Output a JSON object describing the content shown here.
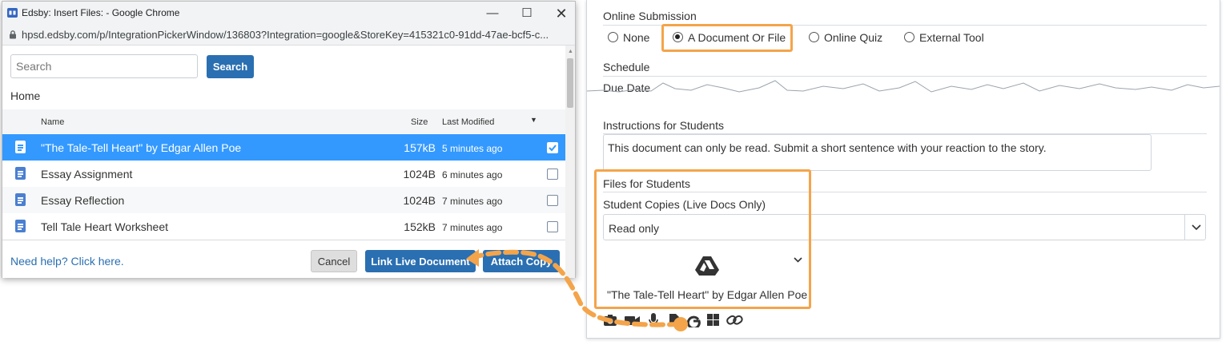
{
  "popup": {
    "title": "Edsby: Insert Files: - Google Chrome",
    "url": "hpsd.edsby.com/p/IntegrationPickerWindow/136803?Integration=google&StoreKey=415321c0-91dd-47ae-bcf5-c...",
    "search_placeholder": "Search",
    "search_button": "Search",
    "folder": "Home",
    "columns": {
      "name": "Name",
      "size": "Size",
      "modified": "Last Modified"
    },
    "files": [
      {
        "name": "\"The Tale-Tell Heart\" by Edgar Allen Poe",
        "size": "157kB",
        "modified": "5 minutes ago",
        "selected": true
      },
      {
        "name": "Essay Assignment",
        "size": "1024B",
        "modified": "6 minutes ago",
        "selected": false
      },
      {
        "name": "Essay Reflection",
        "size": "1024B",
        "modified": "7 minutes ago",
        "selected": false
      },
      {
        "name": "Tell Tale Heart Worksheet",
        "size": "152kB",
        "modified": "7 minutes ago",
        "selected": false
      }
    ],
    "help_link": "Need help? Click here.",
    "cancel_button": "Cancel",
    "link_button": "Link Live Document",
    "attach_button": "Attach Copy"
  },
  "form": {
    "online_submission_label": "Online Submission",
    "options": [
      "None",
      "A Document Or File",
      "Online Quiz",
      "External Tool"
    ],
    "selected_option": "A Document Or File",
    "schedule_label": "Schedule",
    "due_date_label": "Due Date",
    "instructions_label": "Instructions for Students",
    "instructions_text": "This document can only be read. Submit a short sentence with your reaction to the story.",
    "files_label": "Files for Students",
    "student_copies_label": "Student Copies (Live Docs Only)",
    "student_copies_value": "Read only",
    "attached_file": "\"The Tale-Tell Heart\" by Edgar Allen Poe"
  },
  "colors": {
    "accent": "#2a6fb1",
    "selection": "#3399ff",
    "highlight": "#f4a44a"
  }
}
